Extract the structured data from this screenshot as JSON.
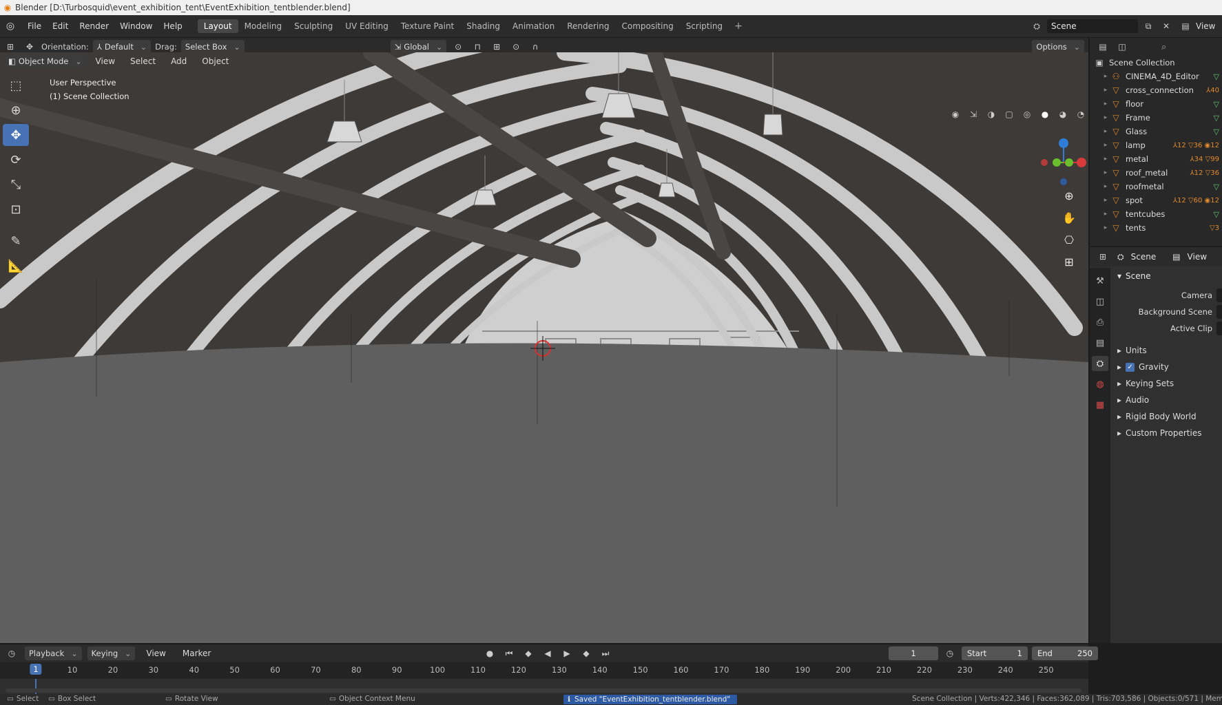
{
  "window": {
    "title": "Blender [D:\\Turbosquid\\event_exhibition_tent\\EventExhibition_tentblender.blend]"
  },
  "menu": [
    "File",
    "Edit",
    "Render",
    "Window",
    "Help"
  ],
  "workspaces": [
    "Layout",
    "Modeling",
    "Sculpting",
    "UV Editing",
    "Texture Paint",
    "Shading",
    "Animation",
    "Rendering",
    "Compositing",
    "Scripting"
  ],
  "active_workspace": "Layout",
  "scene_selector": {
    "value": "Scene"
  },
  "view_layer_label": "View",
  "viewport_header": {
    "orientation_label": "Orientation:",
    "orientation_value": "Default",
    "drag_label": "Drag:",
    "drag_value": "Select Box",
    "transform_orientation": "Global",
    "options_label": "Options"
  },
  "viewport_header2": {
    "mode": "Object Mode",
    "menus": [
      "View",
      "Select",
      "Add",
      "Object"
    ]
  },
  "viewport_info": {
    "line1": "User Perspective",
    "line2": "(1) Scene Collection"
  },
  "outliner": {
    "root": "Scene Collection",
    "items": [
      {
        "name": "CINEMA_4D_Editor",
        "tail": "▽"
      },
      {
        "name": "cross_connection",
        "tail": "⅄40"
      },
      {
        "name": "floor",
        "tail": "▽"
      },
      {
        "name": "Frame",
        "tail": "▽"
      },
      {
        "name": "Glass",
        "tail": "▽"
      },
      {
        "name": "lamp",
        "tail": "⅄12 ▽36 ◉12"
      },
      {
        "name": "metal",
        "tail": "⅄34 ▽99"
      },
      {
        "name": "roof_metal",
        "tail": "⅄12 ▽36"
      },
      {
        "name": "roofmetal",
        "tail": "▽"
      },
      {
        "name": "spot",
        "tail": "⅄12 ▽60 ◉12"
      },
      {
        "name": "tentcubes",
        "tail": "▽"
      },
      {
        "name": "tents",
        "tail": "▽3"
      }
    ]
  },
  "properties": {
    "header_scene": "Scene",
    "header_view": "View",
    "panel_title": "Scene",
    "rows": [
      {
        "label": "Camera"
      },
      {
        "label": "Background Scene"
      },
      {
        "label": "Active Clip"
      }
    ],
    "subpanels": [
      "Units",
      "Gravity",
      "Keying Sets",
      "Audio",
      "Rigid Body World",
      "Custom Properties"
    ]
  },
  "timeline": {
    "menus": [
      "Playback",
      "Keying",
      "View",
      "Marker"
    ],
    "current_frame": "1",
    "start_label": "Start",
    "start_value": "1",
    "end_label": "End",
    "end_value": "250",
    "ticks": [
      "10",
      "20",
      "30",
      "40",
      "50",
      "60",
      "70",
      "80",
      "90",
      "100",
      "110",
      "120",
      "130",
      "140",
      "150",
      "160",
      "170",
      "180",
      "190",
      "200",
      "210",
      "220",
      "230",
      "240",
      "250"
    ]
  },
  "statusbar": {
    "select": "Select",
    "box_select": "Box Select",
    "rotate_view": "Rotate View",
    "context_menu": "Object Context Menu",
    "message": "Saved \"EventExhibition_tentblender.blend\"",
    "stats": "Scene Collection | Verts:422,346 | Faces:362,089 | Tris:703,586 | Objects:0/571 | Mem"
  },
  "colors": {
    "accent": "#4772b3",
    "object_orange": "#e58b2c",
    "mesh_green": "#65c36f"
  }
}
